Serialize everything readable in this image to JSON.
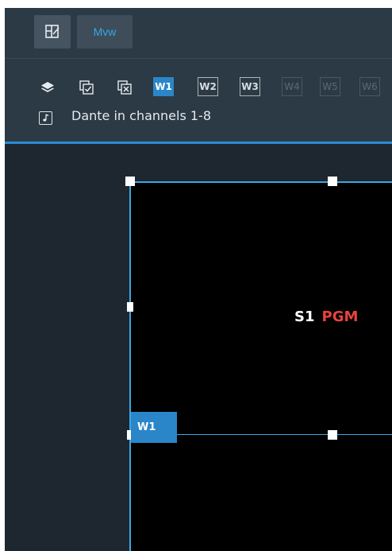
{
  "toolbar": {
    "layout_icon": "layout-edit-icon",
    "mvw_label": "Mvw"
  },
  "tools": {
    "layers_icon": "layers-icon",
    "select_all_icon": "select-all-icon",
    "deselect_all_icon": "deselect-all-icon"
  },
  "windows": [
    {
      "label": "W1",
      "state": "active"
    },
    {
      "label": "W2",
      "state": "normal"
    },
    {
      "label": "W3",
      "state": "normal"
    },
    {
      "label": "W4",
      "state": "disabled"
    },
    {
      "label": "W5",
      "state": "disabled"
    },
    {
      "label": "W6",
      "state": "disabled"
    }
  ],
  "audio": {
    "icon": "music-note-icon",
    "label": "Dante in channels 1-8"
  },
  "canvas": {
    "window_tag": "W1",
    "source": "S1",
    "source_status": "PGM"
  },
  "colors": {
    "accent": "#2a86c9",
    "outline": "#3aa7e4",
    "pgm": "#e8433f",
    "panel": "#2c3a45",
    "background": "#1e2730"
  }
}
